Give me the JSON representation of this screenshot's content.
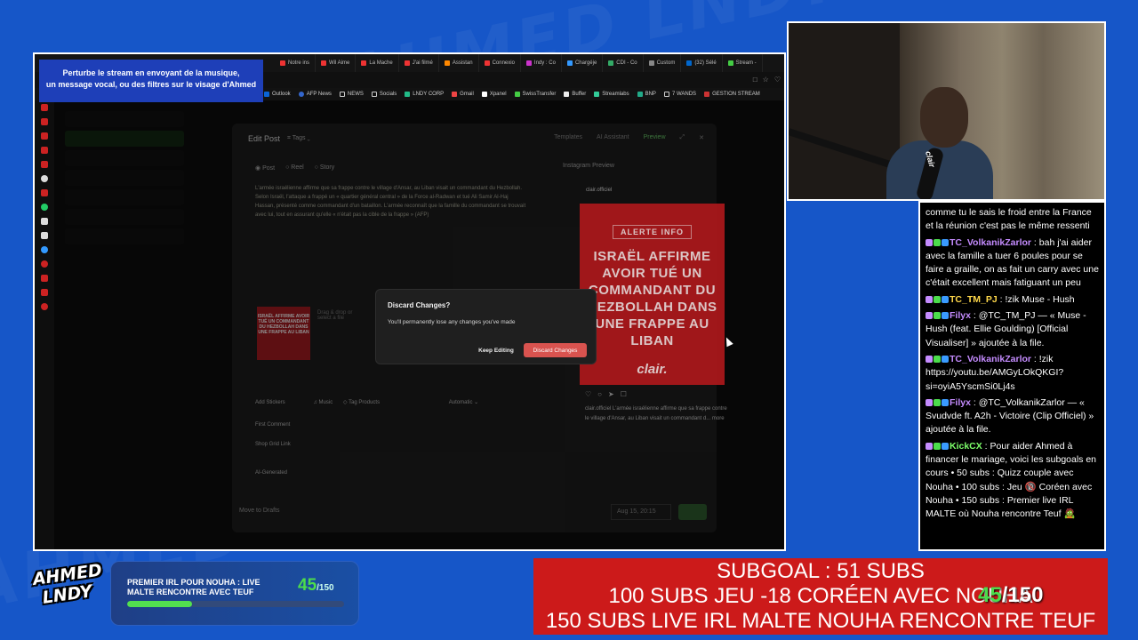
{
  "stream_banner": {
    "line1": "Perturbe le stream en envoyant de la musique,",
    "line2": "un message vocal, ou des filtres sur le visage d'Ahmed"
  },
  "browser": {
    "tabs": [
      "Notre ins",
      "Wil Aime",
      "La Mache",
      "J'ai filmé",
      "Assistan",
      "Connexio",
      "Indy : Co",
      "Chargéje",
      "CDI - Co",
      "Custom",
      "(32) Sélé",
      "Stream -"
    ],
    "bookmarks": [
      "Outlook",
      "AFP News",
      "NEWS",
      "Socials",
      "LNDY CORP",
      "Gmail",
      "Xpanel",
      "SwissTransfer",
      "Buffer",
      "Streamlabs",
      "BNP",
      "7 WANDS",
      "GESTION STREAM"
    ]
  },
  "edit_post": {
    "title": "Edit Post",
    "tags": "Tags",
    "top_actions": [
      "Templates",
      "AI Assistant",
      "Preview"
    ],
    "post_types": [
      "Post",
      "Reel",
      "Story"
    ],
    "text": "L'armée israélienne affirme que sa frappe contre le village d'Ansar, au Liban visait un commandant du Hezbollah. Selon Israël, l'attaque a frappé un « quartier général central » de la Force al-Radwan et tué Ali Samir Al-Haj Hassan, présenté comme commandant d'un bataillon. L'armée reconnaît que la famille du commandant se trouvait avec lui, tout en assurant qu'elle « n'était pas la cible de la frappe » (AFP)",
    "drop_hint": "Drag & drop or select a file",
    "add_stickers": "Add Stickers",
    "music": "Music",
    "tag_products": "Tag Products",
    "automatic": "Automatic",
    "first_comment": "First Comment",
    "shop_grid_link": "Shop Grid Link",
    "ai_generated": "AI-Generated",
    "move_to_drafts": "Move to Drafts",
    "date": "Aug 15, 20:15",
    "instagram_preview": "Instagram Preview",
    "ig_account": "clair.officiel",
    "ig_caption": "clair.officiel L'armée israélienne affirme que sa frappe contre le village d'Ansar, au Liban visait un commandant d... more"
  },
  "ig_card": {
    "alert": "ALERTE INFO",
    "headline": "ISRAËL AFFIRME AVOIR TUÉ UN COMMANDANT DU HEZBOLLAH DANS UNE FRAPPE AU LIBAN",
    "brand": "clair."
  },
  "modal": {
    "title": "Discard Changes?",
    "message": "You'll permanently lose any changes you've made",
    "keep_label": "Keep Editing",
    "discard_label": "Discard Changes"
  },
  "webcam": {
    "mic_label": "clair"
  },
  "chat": {
    "messages": [
      {
        "user": "",
        "text": "comme tu le sais le froid entre la France et la réunion c'est pas le même ressenti",
        "color": "#ffffff"
      },
      {
        "user": "TC_VolkanikZarlor",
        "text": "bah j'ai aider avec la famille a tuer 6 poules pour se faire a graille, on as fait un carry avec une c'était excellent mais fatiguant un peu",
        "color": "#c58cff"
      },
      {
        "user": "TC_TM_PJ",
        "text": "!zik Muse - Hush",
        "color": "#ffd84a"
      },
      {
        "user": "Filyx",
        "text": "@TC_TM_PJ — « Muse - Hush (feat. Ellie Goulding) [Official Visualiser] » ajoutée à la file.",
        "color": "#c58cff"
      },
      {
        "user": "TC_VolkanikZarlor",
        "text": "!zik https://youtu.be/AMGyLOkQKGI?si=oyiA5YscmSi0Lj4s",
        "color": "#c58cff"
      },
      {
        "user": "Filyx",
        "text": "@TC_VolkanikZarlor — « Svudvde ft. A2h - Victoire (Clip Officiel) » ajoutée à la file.",
        "color": "#c58cff"
      },
      {
        "user": "KickCX",
        "text": "Pour aider Ahmed à financer le mariage, voici les subgoals en cours • 50 subs : Quizz couple avec Nouha • 100 subs : Jeu 🔞 Coréen avec Nouha • 150 subs : Premier live IRL MALTE où Nouha rencontre Teuf 🧟",
        "color": "#7dff6a"
      }
    ]
  },
  "logo": {
    "line1": "AHMED",
    "line2": "LNDY"
  },
  "goal": {
    "text_line1": "PREMIER IRL POUR NOUHA : LIVE",
    "text_line2": "MALTE RENCONTRE AVEC TEUF",
    "current": "45",
    "max": "/150",
    "progress": 0.3
  },
  "subgoal": {
    "line1": "SUBGOAL : 51 SUBS",
    "line2": "100 SUBS JEU -18 CORÉEN AVEC NOUHA",
    "line3": "150 SUBS LIVE IRL MALTE NOUHA RENCONTRE TEUF",
    "overlay_count": "45",
    "overlay_max": "/150"
  },
  "colors": {
    "accent_blue": "#1656c8",
    "goal_green": "#4cdc4c",
    "subgoal_red": "#cc1a1a",
    "discard_red": "#d9534f"
  }
}
